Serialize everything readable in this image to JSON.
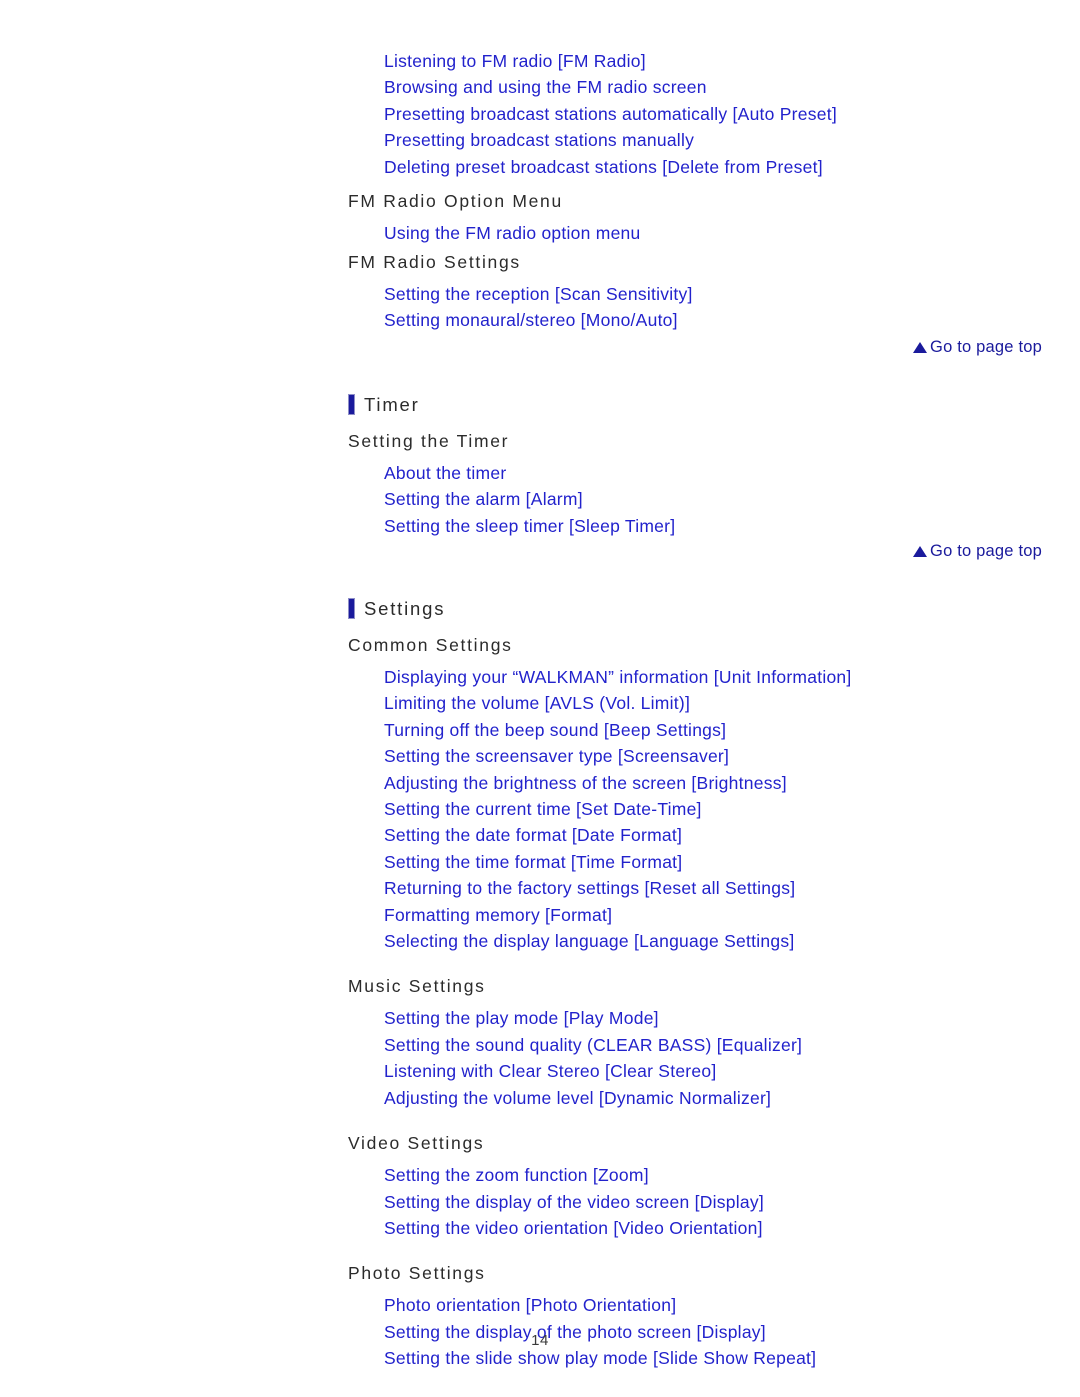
{
  "page": {
    "number": "14",
    "go_to_top_label": "Go to page top"
  },
  "sections": [
    {
      "id": "fm-radio-continued",
      "heading": null,
      "intro_links": [
        "Listening to FM radio [FM Radio]",
        "Browsing and using the FM radio screen",
        "Presetting broadcast stations automatically [Auto Preset]",
        "Presetting broadcast stations manually",
        "Deleting preset broadcast stations [Delete from Preset]"
      ],
      "groups": [
        {
          "title": "FM Radio Option Menu",
          "links": [
            "Using the FM radio option menu"
          ]
        },
        {
          "title": "FM Radio Settings",
          "links": [
            "Setting the reception [Scan Sensitivity]",
            "Setting monaural/stereo [Mono/Auto]"
          ]
        }
      ]
    },
    {
      "id": "timer",
      "heading": "Timer",
      "intro_links": [],
      "groups": [
        {
          "title": "Setting the Timer",
          "links": [
            "About the timer",
            "Setting the alarm [Alarm]",
            "Setting the sleep timer [Sleep Timer]"
          ]
        }
      ]
    },
    {
      "id": "settings",
      "heading": "Settings",
      "intro_links": [],
      "groups": [
        {
          "title": "Common Settings",
          "links": [
            "Displaying your “WALKMAN” information [Unit Information]",
            "Limiting the volume [AVLS (Vol. Limit)]",
            "Turning off the beep sound [Beep Settings]",
            "Setting the screensaver type [Screensaver]",
            "Adjusting the brightness of the screen [Brightness]",
            "Setting the current time [Set Date-Time]",
            "Setting the date format [Date Format]",
            "Setting the time format [Time Format]",
            "Returning to the factory settings [Reset all Settings]",
            "Formatting memory [Format]",
            "Selecting the display language [Language Settings]"
          ]
        },
        {
          "title": "Music Settings",
          "links": [
            "Setting the play mode [Play Mode]",
            "Setting the sound quality (CLEAR BASS) [Equalizer]",
            "Listening with Clear Stereo [Clear Stereo]",
            "Adjusting the volume level [Dynamic Normalizer]"
          ]
        },
        {
          "title": "Video Settings",
          "links": [
            "Setting the zoom function [Zoom]",
            "Setting the display of the video screen [Display]",
            "Setting the video orientation [Video Orientation]"
          ]
        },
        {
          "title": "Photo Settings",
          "links": [
            "Photo orientation [Photo Orientation]",
            "Setting the display of the photo screen [Display]",
            "Setting the slide show play mode [Slide Show Repeat]"
          ]
        }
      ]
    }
  ],
  "go_top_markers": [
    {
      "id": "go-top-1",
      "label": "Go to page top"
    },
    {
      "id": "go-top-2",
      "label": "Go to page top"
    }
  ],
  "colors": {
    "link": "#2222cc",
    "heading_bar": "#1a1a9c",
    "heading_text": "#2b2b2b",
    "go_top": "#1a1a9c",
    "page_number": "#3a3a3a",
    "background": "#ffffff"
  }
}
